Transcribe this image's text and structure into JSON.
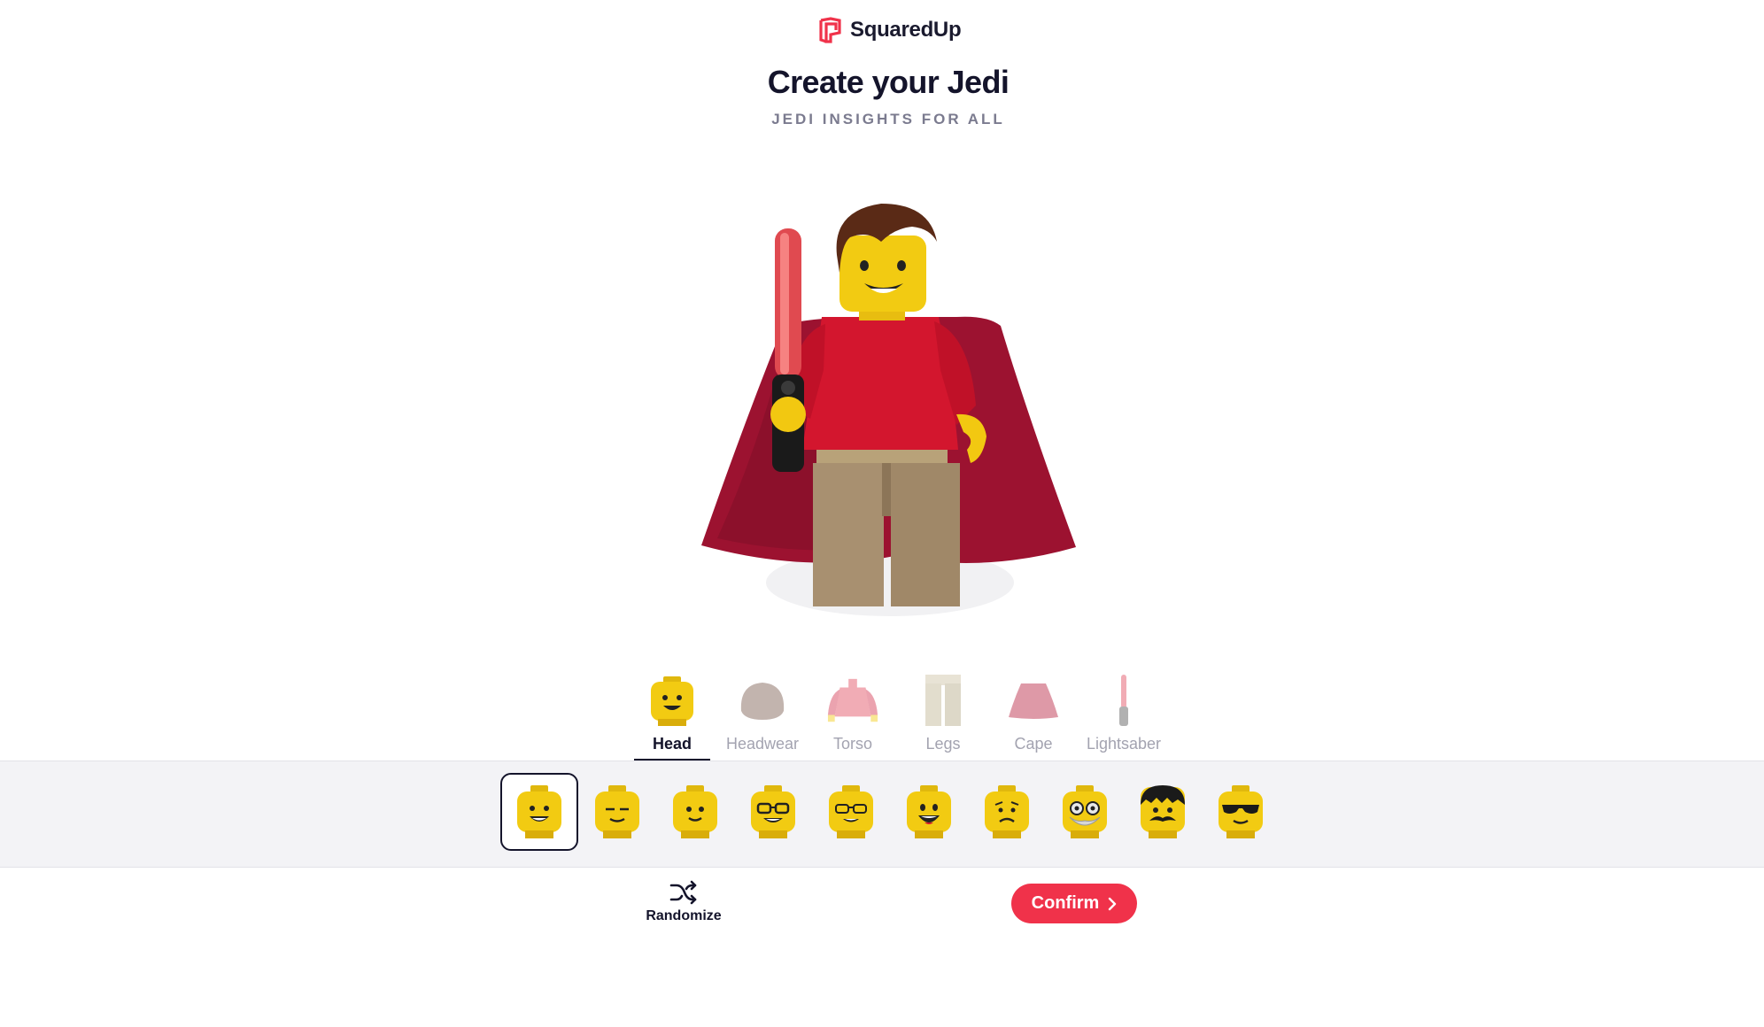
{
  "brand": {
    "name": "SquaredUp",
    "accent": "#f0324a"
  },
  "header": {
    "title": "Create your Jedi",
    "subtitle": "JEDI INSIGHTS FOR ALL"
  },
  "tabs": [
    {
      "label": "Head",
      "icon": "head-icon",
      "active": true
    },
    {
      "label": "Headwear",
      "icon": "hair-icon",
      "active": false
    },
    {
      "label": "Torso",
      "icon": "torso-icon",
      "active": false
    },
    {
      "label": "Legs",
      "icon": "legs-icon",
      "active": false
    },
    {
      "label": "Cape",
      "icon": "cape-icon",
      "active": false
    },
    {
      "label": "Lightsaber",
      "icon": "lightsaber-icon",
      "active": false
    }
  ],
  "head_options": [
    {
      "face": "smile-teeth",
      "selected": true
    },
    {
      "face": "sleepy"
    },
    {
      "face": "neutral-smile"
    },
    {
      "face": "glasses-grin"
    },
    {
      "face": "glasses-smile"
    },
    {
      "face": "open-smile"
    },
    {
      "face": "worried"
    },
    {
      "face": "goggles-beard"
    },
    {
      "face": "hair-mustache"
    },
    {
      "face": "sunglasses"
    }
  ],
  "actions": {
    "randomize_label": "Randomize",
    "confirm_label": "Confirm"
  }
}
